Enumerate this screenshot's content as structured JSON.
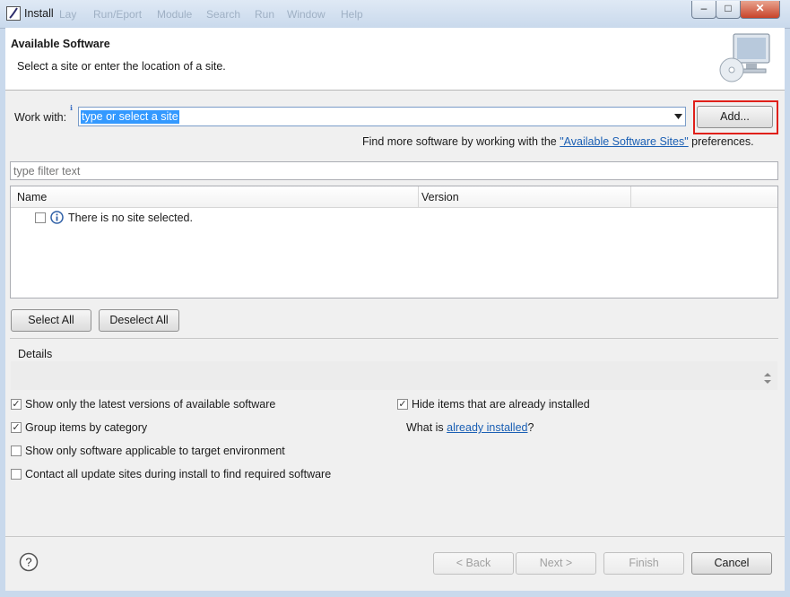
{
  "window": {
    "title": "Install",
    "menu_ghost": [
      "Lay",
      "Run/Eport",
      "Module",
      "Search",
      "Run",
      "Window",
      "Help"
    ]
  },
  "header": {
    "title": "Available Software",
    "subtitle": "Select a site or enter the location of a site."
  },
  "work_with": {
    "label": "Work with:",
    "value": "type or select a site",
    "add_button": "Add...",
    "find_more_prefix": "Find more software by working with the ",
    "find_more_link": "\"Available Software Sites\"",
    "find_more_suffix": " preferences."
  },
  "filter": {
    "placeholder": "type filter text"
  },
  "table": {
    "columns": [
      "Name",
      "Version"
    ],
    "empty_message": "There is no site selected."
  },
  "selection_buttons": {
    "select_all": "Select All",
    "deselect_all": "Deselect All"
  },
  "details": {
    "label": "Details"
  },
  "options": {
    "show_latest": {
      "label": "Show only the latest versions of available software",
      "checked": true
    },
    "group_by_category": {
      "label": "Group items by category",
      "checked": true
    },
    "applicable_only": {
      "label": "Show only software applicable to target environment",
      "checked": false
    },
    "contact_all": {
      "label": "Contact all update sites during install to find required software",
      "checked": false
    },
    "hide_installed": {
      "label": "Hide items that are already installed",
      "checked": true
    },
    "what_is_prefix": "What is ",
    "what_is_link": "already installed",
    "what_is_suffix": "?"
  },
  "footer": {
    "back": "< Back",
    "next": "Next >",
    "finish": "Finish",
    "cancel": "Cancel"
  },
  "colors": {
    "highlight_box": "#e0201a",
    "link": "#1a5fb4",
    "selection": "#3399ff"
  }
}
